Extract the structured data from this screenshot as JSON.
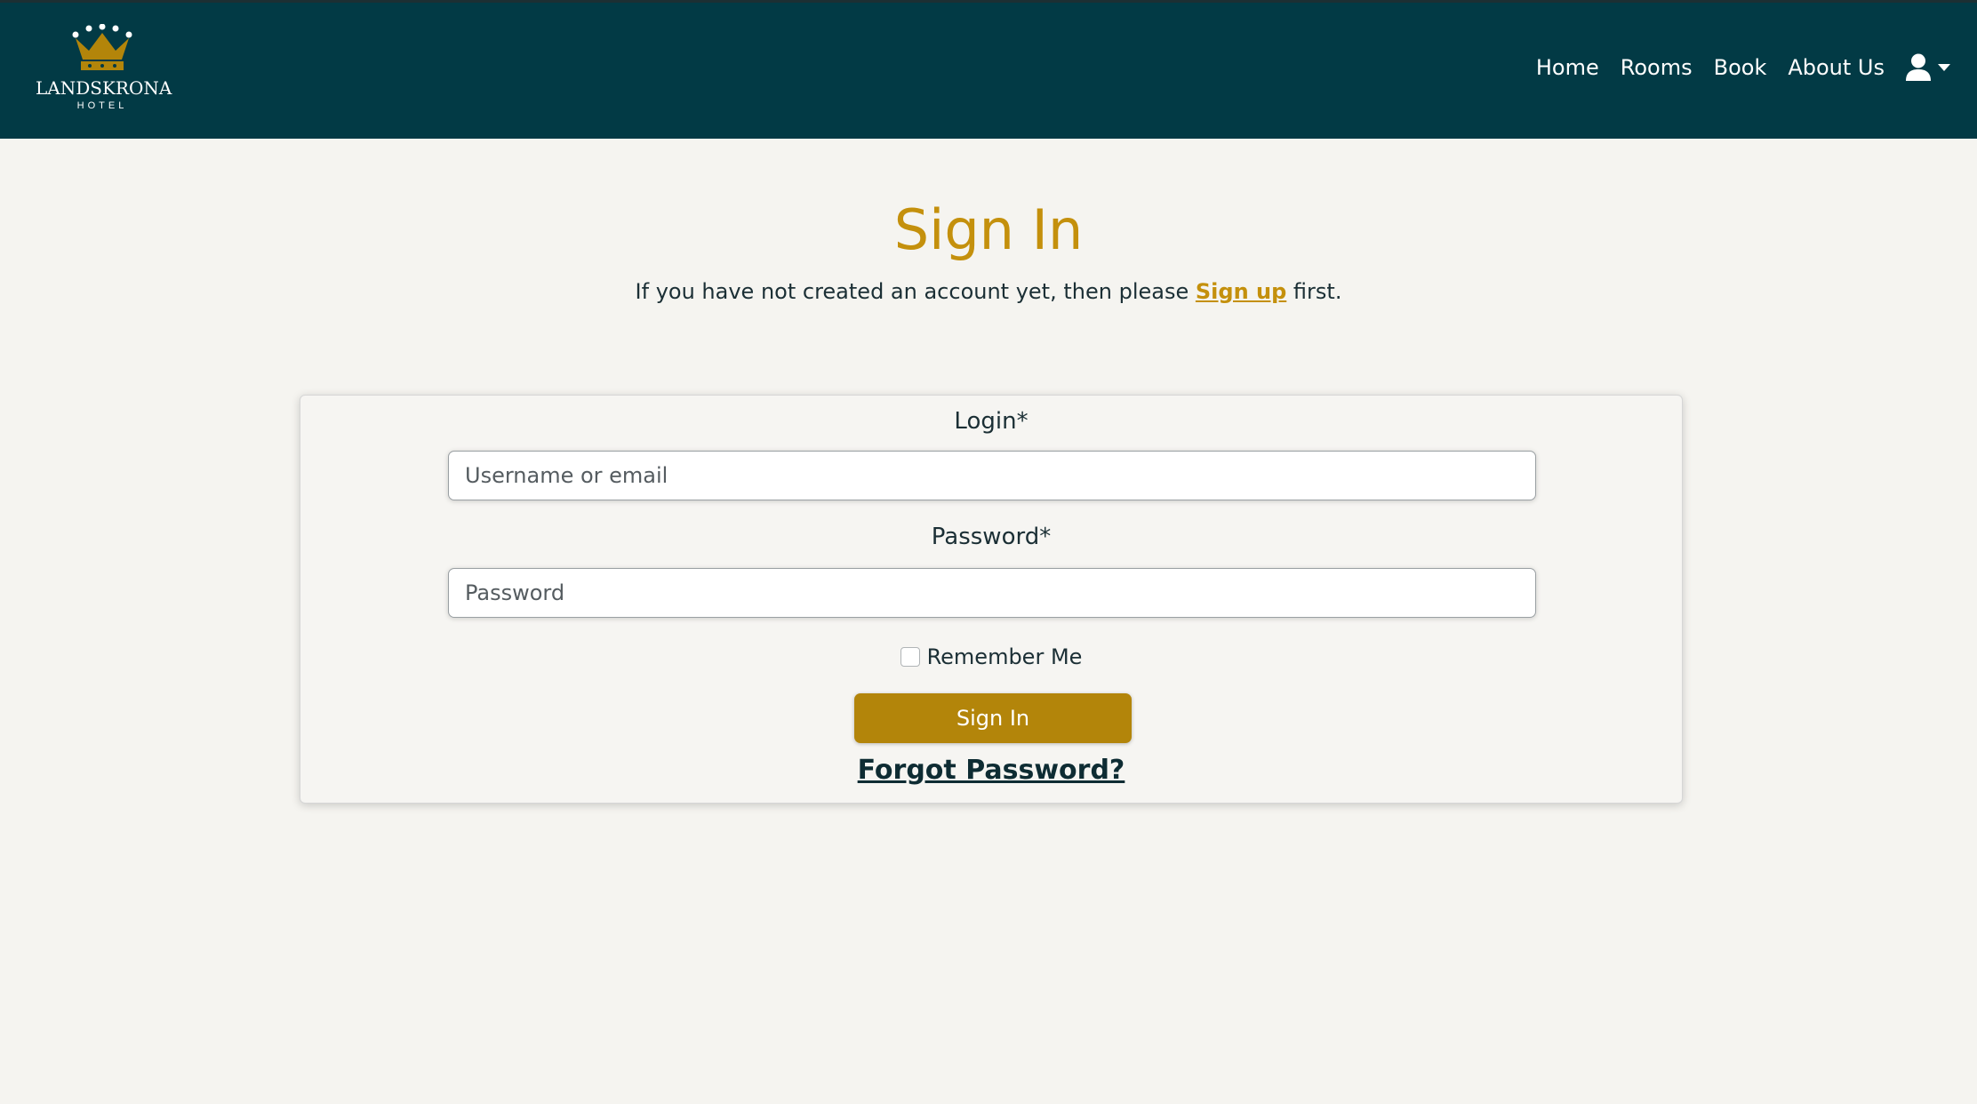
{
  "navbar": {
    "logo": {
      "brand": "LANDSKRONA",
      "sub": "HOTEL",
      "icon": "crown-icon"
    },
    "links": [
      "Home",
      "Rooms",
      "Book",
      "About Us"
    ],
    "user_icon": "user-icon",
    "caret_icon": "chevron-down-icon"
  },
  "page": {
    "title": "Sign In",
    "subtitle_prefix": "If you have not created an account yet, then please",
    "signup_link": "Sign up",
    "subtitle_suffix": "first."
  },
  "form": {
    "login_label": "Login*",
    "login_placeholder": "Username or email",
    "password_label": "Password*",
    "password_placeholder": "Password",
    "remember_label": "Remember Me",
    "remember_checked": false,
    "submit_label": "Sign In",
    "forgot_label": "Forgot Password?"
  },
  "colors": {
    "navbar_bg": "#023a45",
    "accent_gold": "#c4900c",
    "button_gold": "#b3850a",
    "page_bg": "#f5f4f0"
  }
}
